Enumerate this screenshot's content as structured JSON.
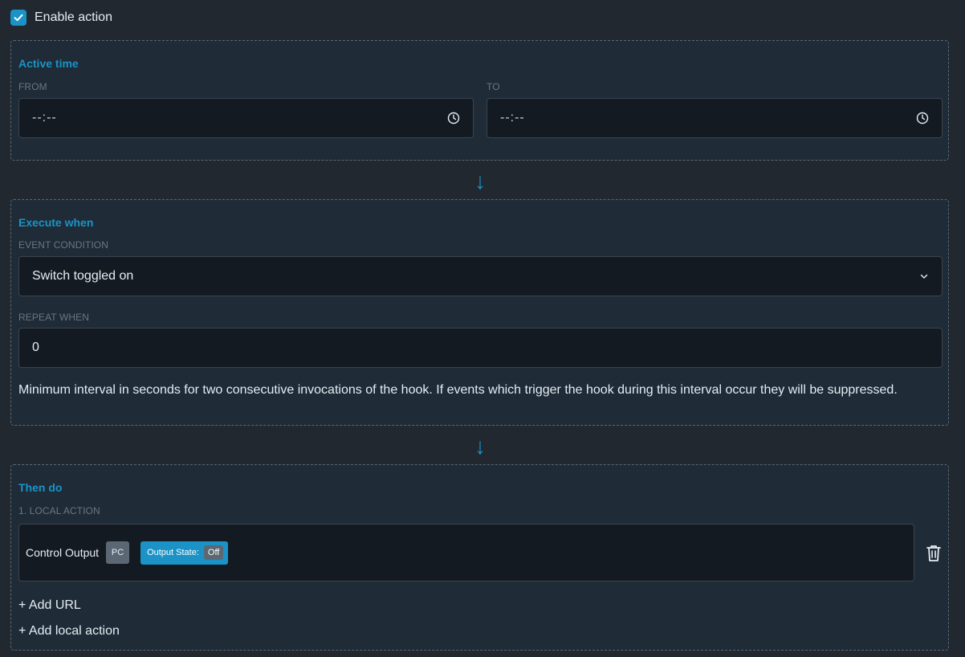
{
  "enable": {
    "label": "Enable action",
    "checked": true
  },
  "active_time": {
    "title": "Active time",
    "from_label": "FROM",
    "from_value": "--:--",
    "to_label": "TO",
    "to_value": "--:--"
  },
  "execute_when": {
    "title": "Execute when",
    "event_label": "EVENT CONDITION",
    "event_value": "Switch toggled on",
    "repeat_label": "REPEAT WHEN",
    "repeat_value": "0",
    "help": "Minimum interval in seconds for two consecutive invocations of the hook. If events which trigger the hook during this interval occur they will be suppressed."
  },
  "then_do": {
    "title": "Then do",
    "action_label": "1. LOCAL ACTION",
    "action": {
      "name": "Control Output",
      "badge": "PC",
      "state_label": "Output State:",
      "state_value": "Off"
    },
    "add_url": "+ Add URL",
    "add_local_action": "+ Add local action"
  },
  "colors": {
    "accent": "#1b93c6",
    "background": "#212830",
    "panel": "#1f2b37",
    "input": "#131a21"
  },
  "icons": [
    "check-icon",
    "clock-icon",
    "chevron-down-icon",
    "arrow-down-icon",
    "trash-icon"
  ]
}
